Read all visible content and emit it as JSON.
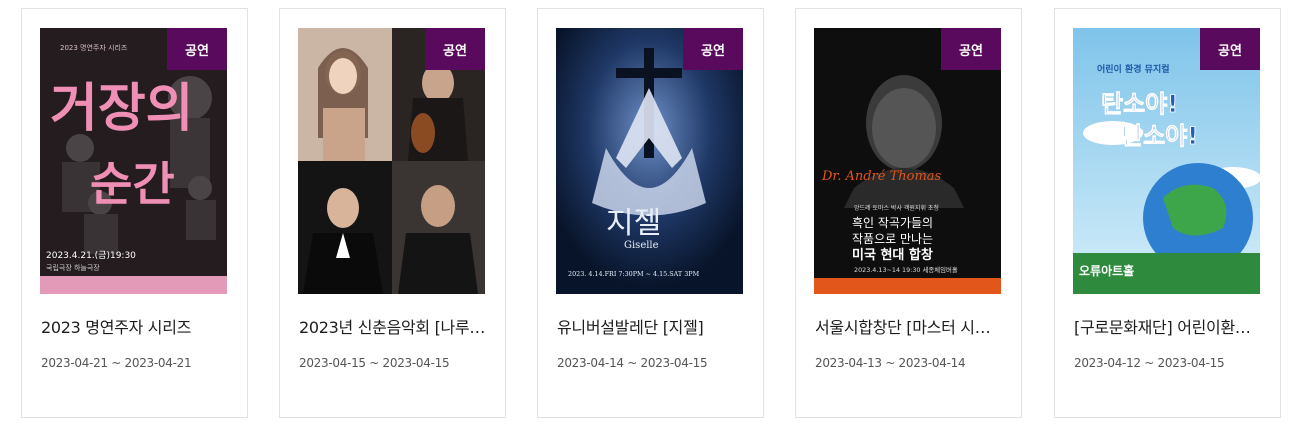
{
  "badge_color": "#5a0a5c",
  "cards": [
    {
      "badge": "공연",
      "title": "2023 명연주자 시리즈",
      "start": "2023-04-21",
      "sep": " ~ ",
      "end": "2023-04-21",
      "poster": {
        "headline_top": "거장의",
        "headline_bottom": "순간",
        "series_label": "2023 명연주자 시리즈",
        "date_text": "2023.4.21.(금)19:30",
        "venue_text": "국립극장 하늘극장"
      }
    },
    {
      "badge": "공연",
      "title": "2023년 신춘음악회 [나루 …",
      "start": "2023-04-15",
      "sep": " ~ ",
      "end": "2023-04-15",
      "poster": {}
    },
    {
      "badge": "공연",
      "title": "유니버설발레단 [지젤]",
      "start": "2023-04-14",
      "sep": " ~ ",
      "end": "2023-04-15",
      "poster": {
        "headline": "지젤",
        "subtitle": "Giselle",
        "date_text": "2023. 4.14.FRI 7:30PM ~ 4.15.SAT 3PM"
      }
    },
    {
      "badge": "공연",
      "title": "서울시합창단 [마스터 시…",
      "start": "2023-04-13",
      "sep": " ~ ",
      "end": "2023-04-14",
      "poster": {
        "script_name": "Dr. André Thomas",
        "line1": "앙드레 토마스 박사 객원지휘 초청",
        "line2": "흑인 작곡가들의",
        "line3": "작품으로 만나는",
        "line4": "미국 현대 합창",
        "date_text": "2023.4.13~14 19:30 세종체임버홀"
      }
    },
    {
      "badge": "공연",
      "title": "[구로문화재단] 어린이환…",
      "start": "2023-04-12",
      "sep": " ~ ",
      "end": "2023-04-15",
      "poster": {
        "top_label": "어린이 환경 뮤지컬",
        "headline_top": "탄소야!",
        "headline_bottom": "탄소야!",
        "venue_text": "오류아트홀"
      }
    }
  ]
}
